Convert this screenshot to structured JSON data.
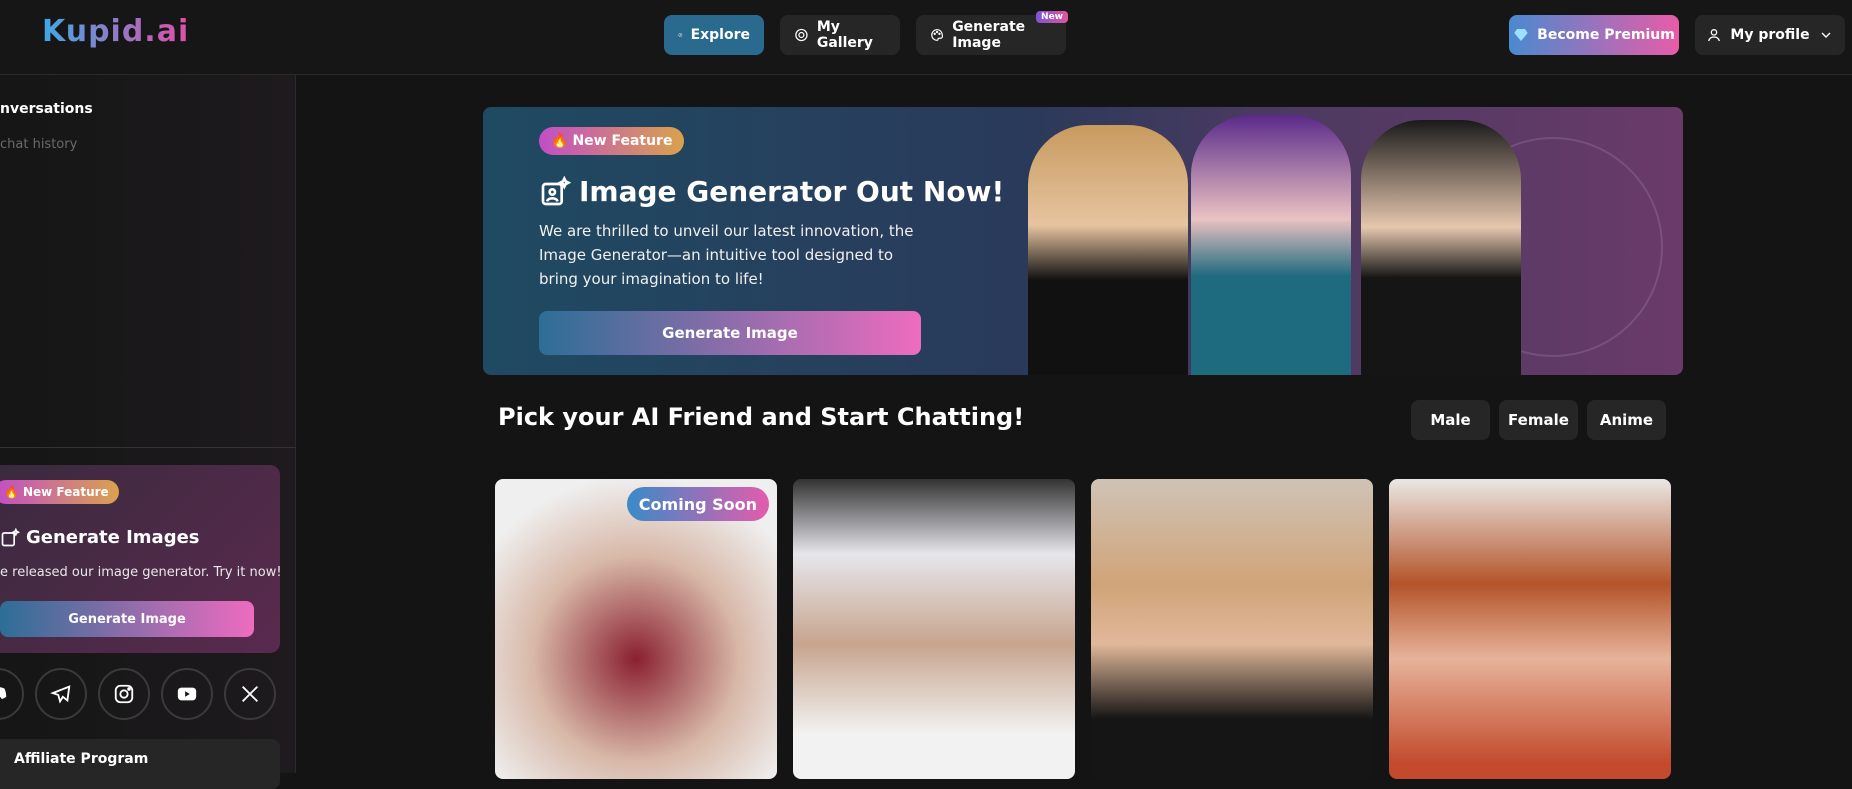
{
  "app": {
    "logo": "Kupid.ai"
  },
  "nav": {
    "explore": "Explore",
    "gallery": "My Gallery",
    "generate": "Generate Image",
    "generate_badge": "New",
    "premium": "Become Premium",
    "profile": "My profile"
  },
  "sidebar": {
    "title": "nversations",
    "subtitle": "chat history",
    "promo": {
      "badge": "New Feature",
      "title": "Generate Images",
      "text": "e released our image generator. Try it now!",
      "button": "Generate Image"
    },
    "socials": [
      "discord-icon",
      "telegram-icon",
      "instagram-icon",
      "youtube-icon",
      "x-icon"
    ],
    "affiliate": "Affiliate Program"
  },
  "hero": {
    "badge": "New Feature",
    "title": "Image Generator Out Now!",
    "text": "We are thrilled to unveil our latest innovation, the Image Generator—an intuitive tool designed to bring your imagination to life!",
    "button": "Generate Image"
  },
  "main": {
    "section_title": "Pick your AI Friend and Start Chatting!",
    "filters": [
      "Male",
      "Female",
      "Anime"
    ],
    "cards": [
      {
        "badge": "Coming Soon"
      }
    ]
  },
  "colors": {
    "accent_start": "#2d6e96",
    "accent_end": "#ee6cbf"
  }
}
